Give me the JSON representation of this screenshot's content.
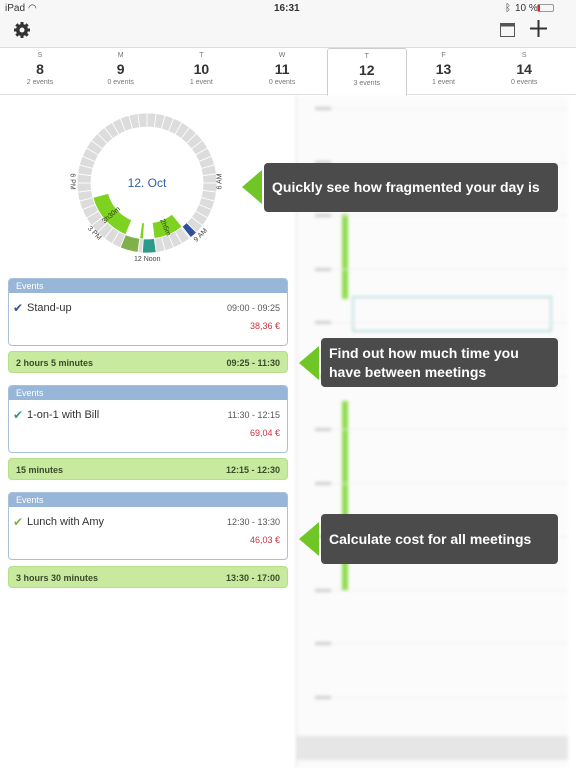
{
  "status": {
    "device": "iPad",
    "time": "16:31",
    "battery": "10 %"
  },
  "toolbar": {
    "settings_icon": "gear-icon",
    "calendar_icon": "calendar-icon",
    "add_icon": "plus-icon"
  },
  "week": [
    {
      "dow": "S",
      "num": "8",
      "events": "2 events"
    },
    {
      "dow": "M",
      "num": "9",
      "events": "0 events"
    },
    {
      "dow": "T",
      "num": "10",
      "events": "1 event"
    },
    {
      "dow": "W",
      "num": "11",
      "events": "0 events"
    },
    {
      "dow": "T",
      "num": "12",
      "events": "3 events",
      "selected": true
    },
    {
      "dow": "F",
      "num": "13",
      "events": "1 event"
    },
    {
      "dow": "S",
      "num": "14",
      "events": "0 events"
    }
  ],
  "dial": {
    "date": "12. Oct",
    "labels": {
      "six_am": "6 AM",
      "nine_am": "9 AM",
      "noon": "12 Noon",
      "three_pm": "3 PM",
      "six_pm": "6 PM"
    },
    "events": [
      {
        "start": 9,
        "end": 9.4167,
        "color": "#2f4fa0"
      },
      {
        "start": 11.5,
        "end": 12.25,
        "color": "#2a9a8a"
      },
      {
        "start": 12.5,
        "end": 13.5,
        "color": "#7fb04a"
      }
    ],
    "free": [
      {
        "start": 9.4167,
        "end": 11.5,
        "label": "2h5m"
      },
      {
        "start": 12.25,
        "end": 12.5,
        "label": ""
      },
      {
        "start": 13.5,
        "end": 17,
        "label": "3h30m"
      }
    ]
  },
  "list": {
    "events": [
      {
        "header": "Events",
        "title": "Stand-up",
        "time": "09:00 - 09:25",
        "cost": "38,36 €",
        "check_color": "#2f4fa0"
      },
      {
        "header": "Events",
        "title": "1-on-1 with Bill",
        "time": "11:30 - 12:15",
        "cost": "69,04 €",
        "check_color": "#2a9a8a"
      },
      {
        "header": "Events",
        "title": "Lunch with Amy",
        "time": "12:30 - 13:30",
        "cost": "46,03 €",
        "check_color": "#7fb04a"
      }
    ],
    "gaps": [
      {
        "duration": "2 hours 5 minutes",
        "range": "09:25 - 11:30"
      },
      {
        "duration": "15 minutes",
        "range": "12:15 - 12:30"
      },
      {
        "duration": "3 hours 30 minutes",
        "range": "13:30 - 17:00"
      }
    ]
  },
  "callouts": [
    "Quickly see how fragmented your day is",
    "Find out how much time you have between meetings",
    "Calculate cost for all meetings"
  ],
  "colors": {
    "accent_green": "#6fc625",
    "callout_bg": "#4b4b4b",
    "event_header": "#97b6d8",
    "free_bg": "#c7ea9f",
    "cost": "#c8313e"
  }
}
